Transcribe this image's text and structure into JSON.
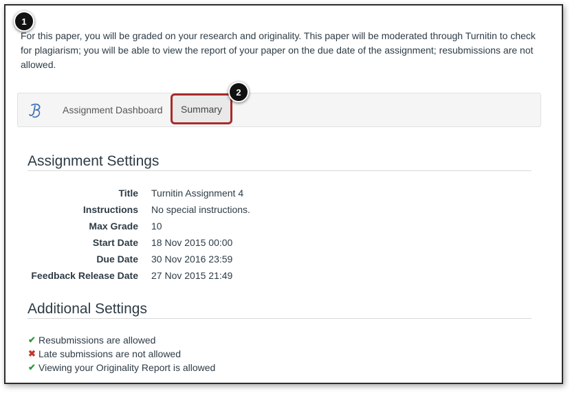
{
  "callouts": {
    "first": "1",
    "second": "2"
  },
  "intro_text": "For this paper, you will be graded on your research and originality. This paper will be moderated through Turnitin to check for plagiarism; you will be able to view the report of your paper on the due date of the assignment; resubmissions are not allowed.",
  "tabs": {
    "dashboard": "Assignment Dashboard",
    "summary": "Summary"
  },
  "assignment_settings": {
    "heading": "Assignment Settings",
    "rows": [
      {
        "label": "Title",
        "value": "Turnitin Assignment 4"
      },
      {
        "label": "Instructions",
        "value": "No special instructions."
      },
      {
        "label": "Max Grade",
        "value": "10"
      },
      {
        "label": "Start Date",
        "value": "18 Nov 2015 00:00"
      },
      {
        "label": "Due Date",
        "value": "30 Nov 2016 23:59"
      },
      {
        "label": "Feedback Release Date",
        "value": "27 Nov 2015 21:49"
      }
    ]
  },
  "additional_settings": {
    "heading": "Additional Settings",
    "items": [
      {
        "text": "Resubmissions are allowed",
        "status": "allowed",
        "mark": "✔"
      },
      {
        "text": "Late submissions are not allowed",
        "status": "not-allowed",
        "mark": "✖"
      },
      {
        "text": "Viewing your Originality Report is allowed",
        "status": "allowed",
        "mark": "✔"
      }
    ]
  },
  "colors": {
    "allowed": "#2e9a3e",
    "not_allowed": "#c0392b",
    "highlight_border": "#a82a2a",
    "text": "#2d3b45"
  },
  "icons": {
    "logo": "turnitin-logo-icon",
    "allowed": "check-icon",
    "not_allowed": "x-icon"
  }
}
